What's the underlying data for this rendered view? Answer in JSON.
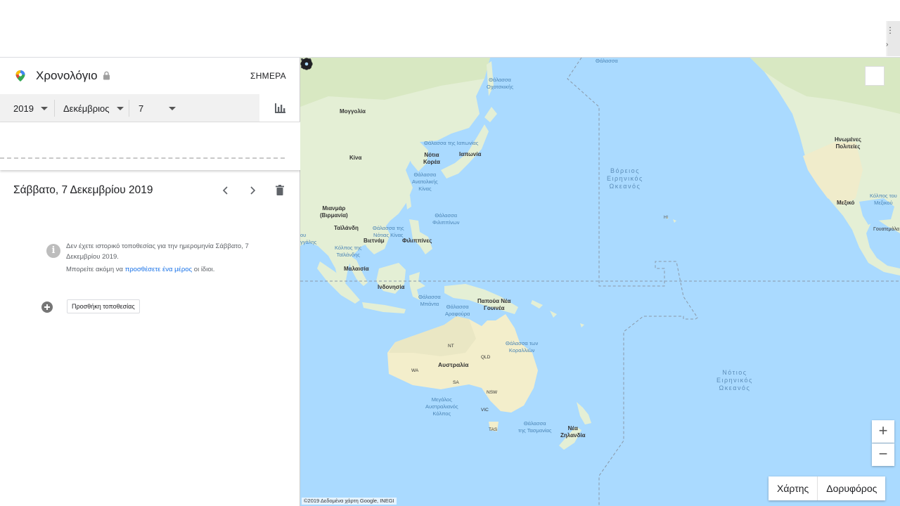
{
  "header": {
    "title": "Χρονολόγιο",
    "today_label": "ΣΗΜΕΡΑ"
  },
  "date_picker": {
    "year": "2019",
    "month": "Δεκέμβριος",
    "day": "7"
  },
  "day": {
    "title": "Σάββατο, 7 Δεκεμβρίου 2019",
    "info_line1": "Δεν έχετε ιστορικό τοποθεσίας για την ημερομηνία Σάββατο, 7 Δεκεμβρίου 2019.",
    "info_line2_before": "Μπορείτε ακόμη να ",
    "info_line2_link": "προσθέσετε ένα μέρος",
    "info_line2_after": " οι ίδιοι.",
    "add_place_label": "Προσθήκη τοποθεσίας"
  },
  "map": {
    "labels": {
      "mongolia": "Μογγολία",
      "china": "Κίνα",
      "south_korea": "Νότια\nΚορέα",
      "japan": "Ιαπωνία",
      "sea_of_japan": "Θάλασσα της Ιαπωνίας",
      "okhotsk": "Θάλασσα\nΟχοτσκικής",
      "east_china_sea": "Θάλασσα\nΑνατολικής\nΚίνας",
      "philippine_sea": "Θάλασσα\nΦιλιππίνων",
      "myanmar": "Μιανμάρ\n(Βιρμανία)",
      "thailand": "Ταϊλάνδη",
      "vietnam": "Βιετνάμ",
      "philippines": "Φιλιππίνες",
      "south_china_sea": "Θάλασσα της\nΝότιας Κίνας",
      "gulf_thailand": "Κόλπος της\nΤαϊλάνδης",
      "gulf_bengal": "ου\nγγάλης",
      "malaysia": "Μαλαισία",
      "indonesia": "Ινδονησία",
      "banda_sea": "Θάλασσα\nΜπάντα",
      "arafura": "Θάλασσα\nΑραφούρα",
      "png": "Παπούα Νέα\nΓουινέα",
      "coral_sea": "Θάλασσα των\nΚοραλλιών",
      "australia": "Αυστραλία",
      "nt": "NT",
      "qld": "QLD",
      "wa": "WA",
      "sa": "SA",
      "nsw": "NSW",
      "vic": "VIC",
      "tas": "TAS",
      "bight": "Μεγάλος\nΑυστραλιανός\nΚόλπος",
      "tasman": "Θάλασσα\nτης Τασμανίας",
      "nz": "Νέα\nΖηλανδία",
      "north_pacific": "Βόρειος\nΕιρηνικός\nΩκεανός",
      "south_pacific": "Νότιος\nΕιρηνικός\nΩκεανός",
      "hi": "HI",
      "usa": "Ηνωμένες\nΠολιτείες",
      "mexico": "Μεξικό",
      "gulf_mexico": "Κόλπος του\nΜεξικού",
      "guatemala": "Γουατεμάλα",
      "bering": "Θάλασσα",
      "bering_top": "Θάλασσα"
    },
    "map_label": "Χάρτης",
    "satellite_label": "Δορυφόρος",
    "zoom_in": "+",
    "zoom_out": "−",
    "copyright": "©2019 Δεδομένα χάρτη Google, INEGI"
  }
}
